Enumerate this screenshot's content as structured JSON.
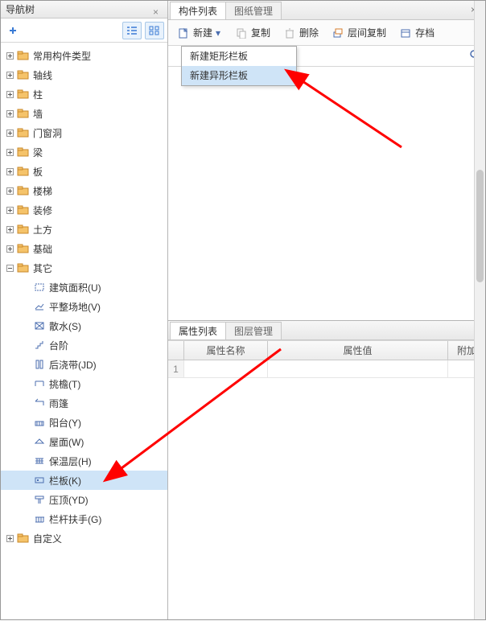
{
  "nav": {
    "title": "导航树",
    "categories": [
      "常用构件类型",
      "轴线",
      "柱",
      "墙",
      "门窗洞",
      "梁",
      "板",
      "楼梯",
      "装修",
      "土方",
      "基础"
    ],
    "other_label": "其它",
    "other_children": [
      {
        "label": "建筑面积(U)",
        "icon": "area"
      },
      {
        "label": "平整场地(V)",
        "icon": "level"
      },
      {
        "label": "散水(S)",
        "icon": "sanshui"
      },
      {
        "label": "台阶",
        "icon": "stairs"
      },
      {
        "label": "后浇带(JD)",
        "icon": "houjiao"
      },
      {
        "label": "挑檐(T)",
        "icon": "tiaoyan"
      },
      {
        "label": "雨篷",
        "icon": "yupeng"
      },
      {
        "label": "阳台(Y)",
        "icon": "yangtai"
      },
      {
        "label": "屋面(W)",
        "icon": "wumian"
      },
      {
        "label": "保温层(H)",
        "icon": "baowen"
      },
      {
        "label": "栏板(K)",
        "icon": "lanban",
        "selected": true
      },
      {
        "label": "压顶(YD)",
        "icon": "yading"
      },
      {
        "label": "栏杆扶手(G)",
        "icon": "langan"
      }
    ],
    "custom_label": "自定义"
  },
  "component": {
    "tab1": "构件列表",
    "tab2": "图纸管理",
    "btn_new": "新建",
    "btn_copy": "复制",
    "btn_delete": "删除",
    "btn_floor_copy": "层间复制",
    "btn_archive": "存档",
    "dropdown": [
      "新建矩形栏板",
      "新建异形栏板"
    ],
    "search_placeholder": ""
  },
  "prop": {
    "tab1": "属性列表",
    "tab2": "图层管理",
    "col_name": "属性名称",
    "col_value": "属性值",
    "col_extra": "附加",
    "row1_idx": "1"
  }
}
